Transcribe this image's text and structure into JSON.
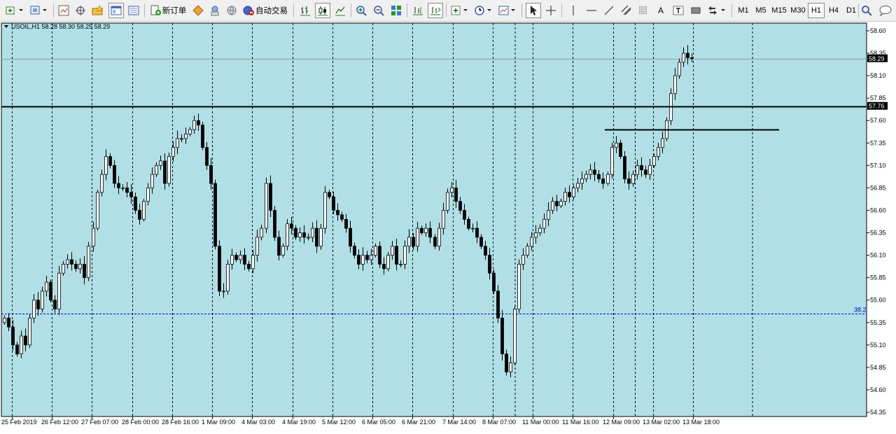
{
  "toolbar": {
    "new_order_label": "新订单",
    "autotrading_label": "自动交易",
    "timeframes": [
      "M1",
      "M5",
      "M15",
      "M30",
      "H1",
      "H4",
      "D1"
    ],
    "active_timeframe": "H1"
  },
  "chart": {
    "info_label": "USOIL,H1  58.28 58.30 58.25 58.29",
    "background": "#b0e0e6",
    "foreground": "#000000",
    "fib_label": "38.2",
    "fib_color": "#0000cd",
    "current_price_tag": "58.29",
    "hline_price_tag": "57.76"
  },
  "chart_data": {
    "type": "candlestick",
    "symbol": "USOIL",
    "timeframe": "H1",
    "ohlc_header": {
      "open": 58.28,
      "high": 58.3,
      "low": 58.25,
      "close": 58.29
    },
    "ylim": [
      54.35,
      58.6
    ],
    "y_ticks": [
      "58.60",
      "58.35",
      "58.10",
      "57.85",
      "57.60",
      "57.35",
      "57.10",
      "56.85",
      "56.60",
      "56.35",
      "56.10",
      "55.85",
      "55.60",
      "55.35",
      "55.10",
      "54.85",
      "54.60",
      "54.35"
    ],
    "x_ticks": [
      "25 Feb 2019",
      "26 Feb 12:00",
      "27 Feb 07:00",
      "28 Feb 00:00",
      "28 Feb 16:00",
      "1 Mar 09:00",
      "4 Mar 03:00",
      "4 Mar 19:00",
      "5 Mar 12:00",
      "6 Mar 05:00",
      "6 Mar 21:00",
      "7 Mar 14:00",
      "8 Mar 07:00",
      "11 Mar 00:00",
      "11 Mar 16:00",
      "12 Mar 09:00",
      "13 Mar 02:00",
      "13 Mar 18:00"
    ],
    "horizontal_line_price": 57.76,
    "trendline_price": 57.5,
    "fib_level_price": 55.45,
    "current_price": 58.29,
    "closes": [
      55.4,
      55.3,
      55.1,
      55.0,
      55.2,
      55.1,
      55.4,
      55.6,
      55.5,
      55.7,
      55.8,
      55.6,
      55.5,
      55.9,
      56.0,
      56.05,
      56.0,
      55.95,
      56.0,
      55.85,
      56.2,
      56.4,
      56.8,
      57.0,
      57.2,
      57.1,
      56.9,
      56.85,
      56.85,
      56.8,
      56.75,
      56.6,
      56.5,
      56.7,
      56.85,
      57.0,
      57.1,
      57.15,
      56.9,
      57.2,
      57.3,
      57.4,
      57.4,
      57.45,
      57.5,
      57.6,
      57.55,
      57.3,
      57.1,
      56.9,
      56.2,
      55.7,
      55.7,
      56.0,
      56.1,
      56.05,
      56.1,
      56.0,
      55.95,
      56.1,
      56.3,
      56.4,
      56.9,
      56.6,
      56.3,
      56.1,
      56.2,
      56.45,
      56.4,
      56.3,
      56.35,
      56.3,
      56.3,
      56.4,
      56.2,
      56.4,
      56.8,
      56.75,
      56.6,
      56.55,
      56.5,
      56.4,
      56.2,
      56.1,
      56.0,
      56.1,
      56.05,
      56.1,
      56.2,
      56.0,
      55.95,
      56.1,
      56.2,
      56.0,
      56.0,
      56.2,
      56.3,
      56.2,
      56.4,
      56.35,
      56.4,
      56.3,
      56.2,
      56.4,
      56.6,
      56.8,
      56.85,
      56.7,
      56.6,
      56.5,
      56.4,
      56.4,
      56.3,
      56.2,
      56.1,
      55.9,
      55.7,
      55.4,
      55.0,
      54.8,
      54.9,
      55.5,
      56.0,
      56.1,
      56.2,
      56.3,
      56.35,
      56.4,
      56.5,
      56.6,
      56.7,
      56.65,
      56.7,
      56.8,
      56.75,
      56.85,
      56.9,
      56.95,
      57.0,
      57.05,
      57.0,
      56.95,
      56.9,
      57.0,
      57.3,
      57.35,
      57.2,
      56.95,
      56.9,
      57.0,
      57.1,
      57.05,
      57.0,
      57.1,
      57.2,
      57.3,
      57.4,
      57.6,
      57.9,
      58.1,
      58.25,
      58.35,
      58.3,
      58.29
    ]
  }
}
